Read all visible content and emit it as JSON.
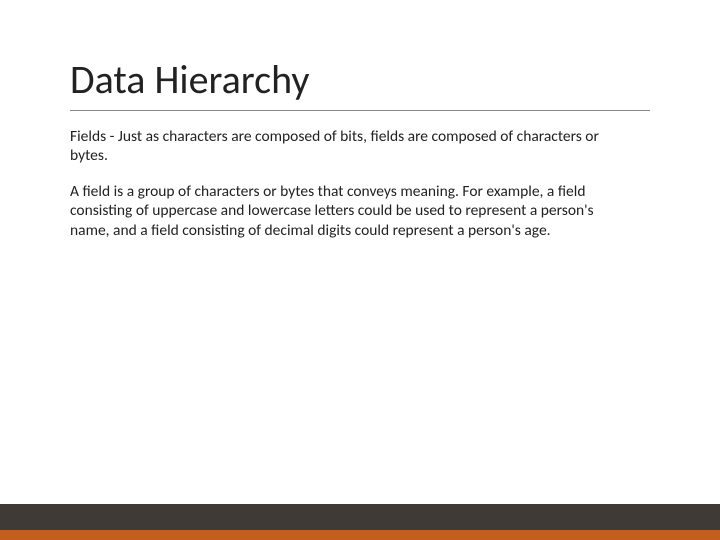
{
  "title": "Data Hierarchy",
  "paragraphs": [
    "Fields - Just as characters are composed of bits, fields are composed of characters or bytes.",
    "A field is a group of characters or bytes that conveys meaning. For example, a field consisting of uppercase and lowercase letters could be used to represent a person's name, and a field consisting of decimal digits could represent a person's age."
  ]
}
